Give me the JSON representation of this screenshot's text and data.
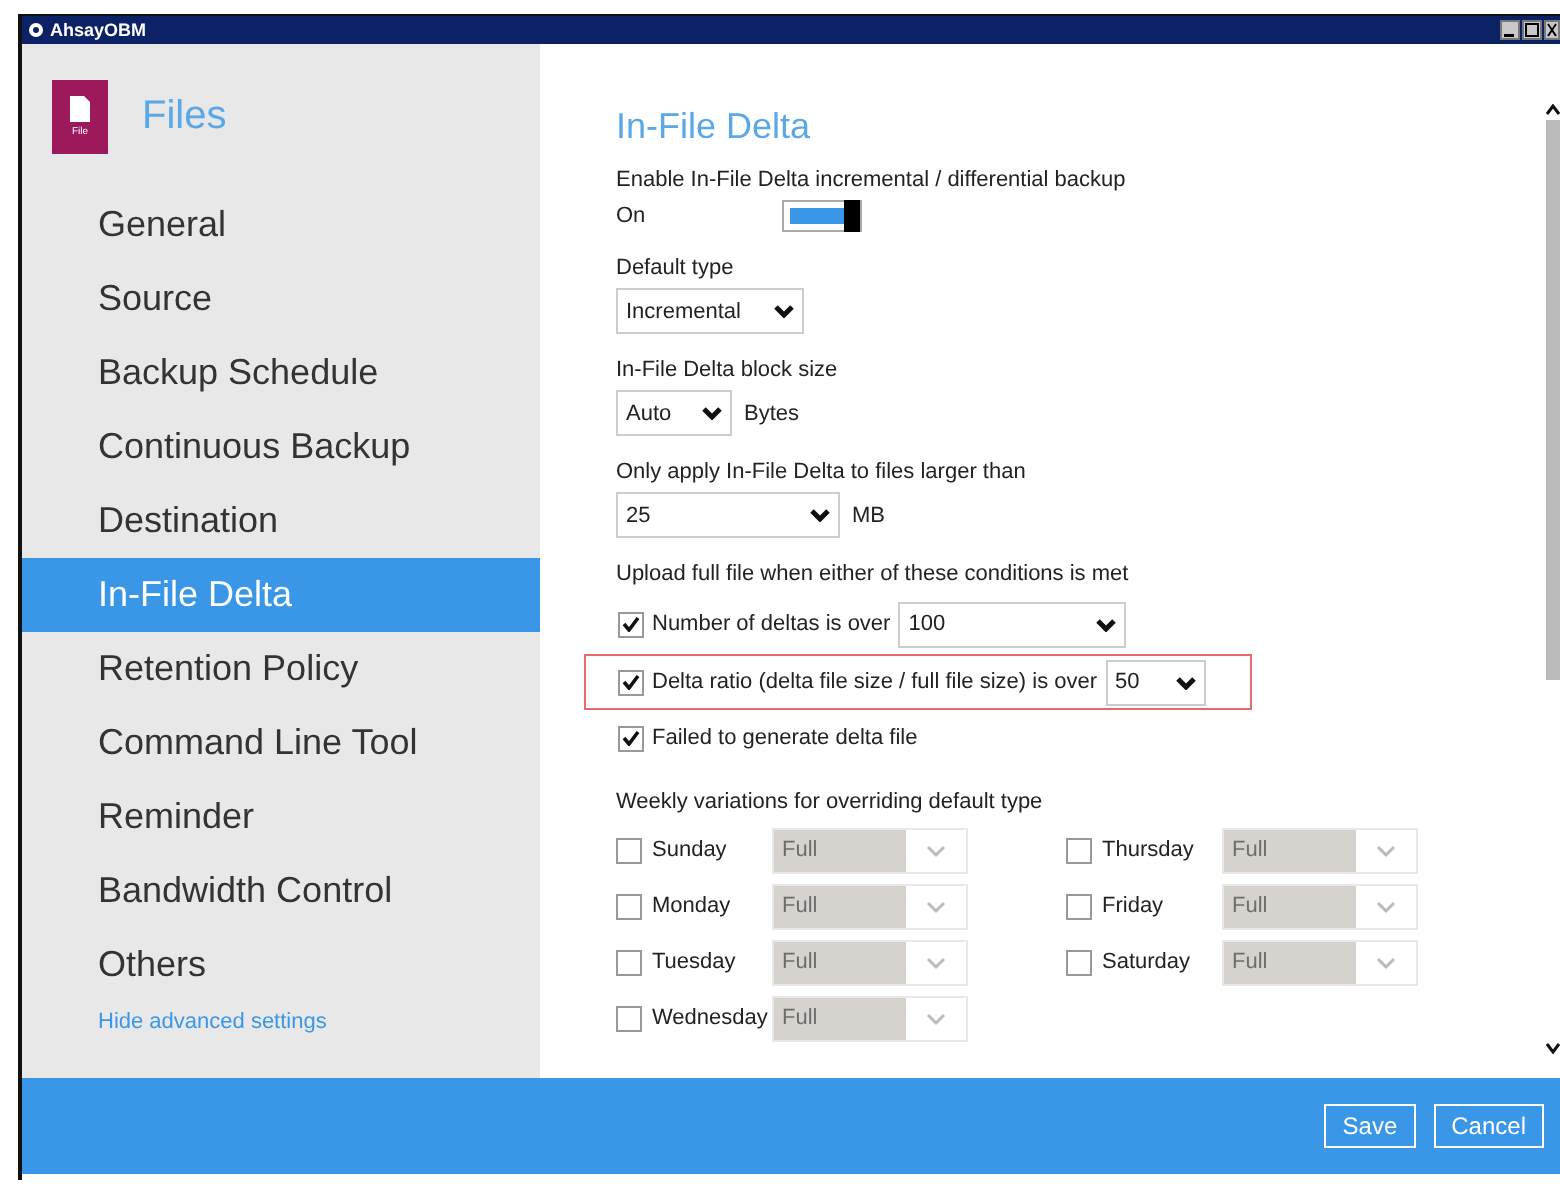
{
  "window": {
    "title": "AhsayOBM"
  },
  "sidebar": {
    "header": {
      "icon_caption": "File",
      "title": "Files"
    },
    "items": [
      {
        "label": "General",
        "selected": false
      },
      {
        "label": "Source",
        "selected": false
      },
      {
        "label": "Backup Schedule",
        "selected": false
      },
      {
        "label": "Continuous Backup",
        "selected": false
      },
      {
        "label": "Destination",
        "selected": false
      },
      {
        "label": "In-File Delta",
        "selected": true
      },
      {
        "label": "Retention Policy",
        "selected": false
      },
      {
        "label": "Command Line Tool",
        "selected": false
      },
      {
        "label": "Reminder",
        "selected": false
      },
      {
        "label": "Bandwidth Control",
        "selected": false
      },
      {
        "label": "Others",
        "selected": false
      }
    ],
    "link": "Hide advanced settings"
  },
  "content": {
    "title": "In-File Delta",
    "enable": {
      "label": "Enable In-File Delta incremental / differential backup",
      "value": "On",
      "on": true
    },
    "default_type": {
      "label": "Default type",
      "value": "Incremental"
    },
    "block_size": {
      "label": "In-File Delta block size",
      "value": "Auto",
      "unit": "Bytes"
    },
    "min_size": {
      "label": "Only apply In-File Delta to files larger than",
      "value": "25",
      "unit": "MB"
    },
    "conditions": {
      "label": "Upload full file when either of these conditions is met",
      "items": [
        {
          "label": "Number of deltas is over",
          "checked": true,
          "value": "100",
          "highlighted": false
        },
        {
          "label": "Delta ratio (delta file size / full file size) is over",
          "checked": true,
          "value": "50",
          "highlighted": true
        },
        {
          "label": "Failed to generate delta file",
          "checked": true,
          "highlighted": false
        }
      ]
    },
    "weekly": {
      "label": "Weekly variations for overriding default type",
      "days": [
        {
          "label": "Sunday",
          "checked": false,
          "value": "Full",
          "disabled": true
        },
        {
          "label": "Monday",
          "checked": false,
          "value": "Full",
          "disabled": true
        },
        {
          "label": "Tuesday",
          "checked": false,
          "value": "Full",
          "disabled": true
        },
        {
          "label": "Wednesday",
          "checked": false,
          "value": "Full",
          "disabled": true
        },
        {
          "label": "Thursday",
          "checked": false,
          "value": "Full",
          "disabled": true
        },
        {
          "label": "Friday",
          "checked": false,
          "value": "Full",
          "disabled": true
        },
        {
          "label": "Saturday",
          "checked": false,
          "value": "Full",
          "disabled": true
        }
      ]
    }
  },
  "buttons": [
    "Save",
    "Cancel"
  ]
}
